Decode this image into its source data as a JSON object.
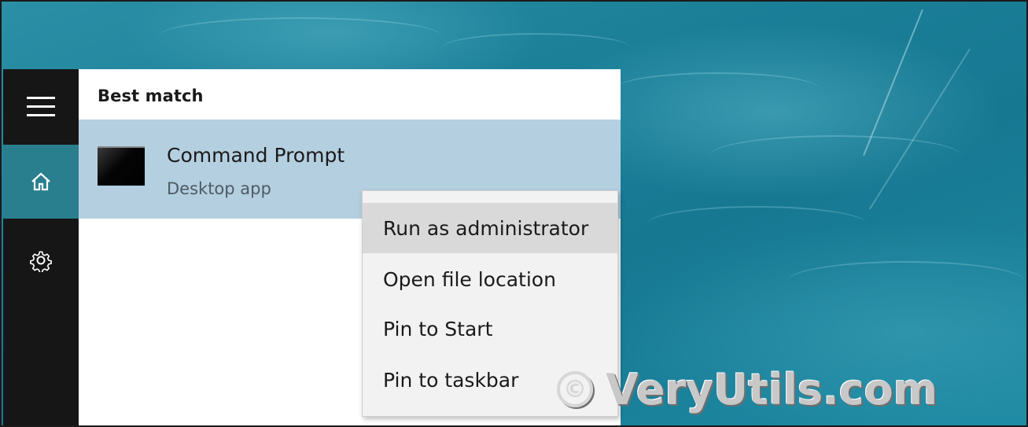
{
  "start_menu": {
    "rail": {
      "menu_icon": "hamburger-icon",
      "home_icon": "home-icon",
      "settings_icon": "gear-icon"
    },
    "results": {
      "section_heading": "Best match",
      "best_match": {
        "icon": "command-prompt-icon",
        "title": "Command Prompt",
        "subtitle": "Desktop app"
      }
    },
    "context_menu": {
      "items": [
        {
          "label": "Run as administrator",
          "highlighted": true
        },
        {
          "label": "Open file location",
          "highlighted": false
        },
        {
          "label": "Pin to Start",
          "highlighted": false
        },
        {
          "label": "Pin to taskbar",
          "highlighted": false
        }
      ]
    }
  },
  "watermark": {
    "symbol": "©",
    "text": "VeryUtils.com"
  },
  "colors": {
    "rail_bg": "#161616",
    "rail_active": "#2a7f8e",
    "result_highlight": "#b4cfe0",
    "menu_bg": "#f2f2f2",
    "menu_highlight": "#d9d9d9"
  }
}
